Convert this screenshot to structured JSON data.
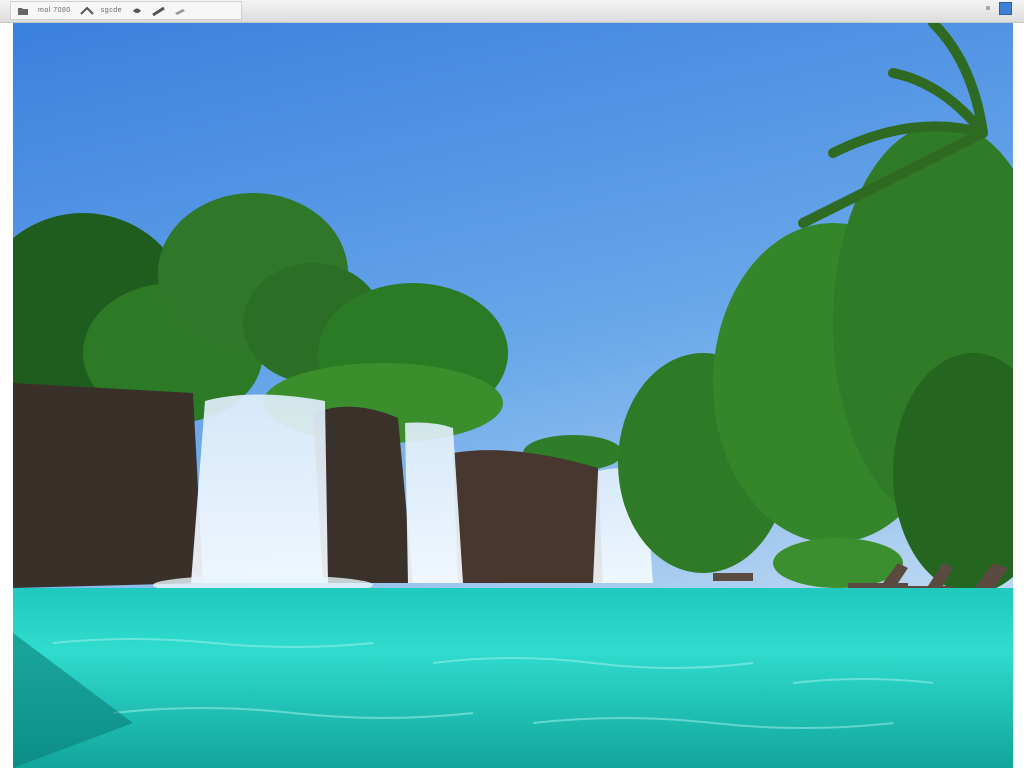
{
  "toolbar": {
    "text_1": "mol 7080",
    "text_2": "sgcde"
  },
  "icons": [
    "folder-icon",
    "pen-icon",
    "bucket-icon",
    "brush-icon",
    "eraser-icon"
  ],
  "colors": {
    "sky_top": "#3f86e0",
    "sky_bottom": "#b9d7f1",
    "pool_light": "#3fe3d4",
    "pool_deep": "#0b8a84",
    "foliage": "#2f7f2a",
    "rock": "#3a2f2a",
    "deck": "#e8e4dc"
  }
}
